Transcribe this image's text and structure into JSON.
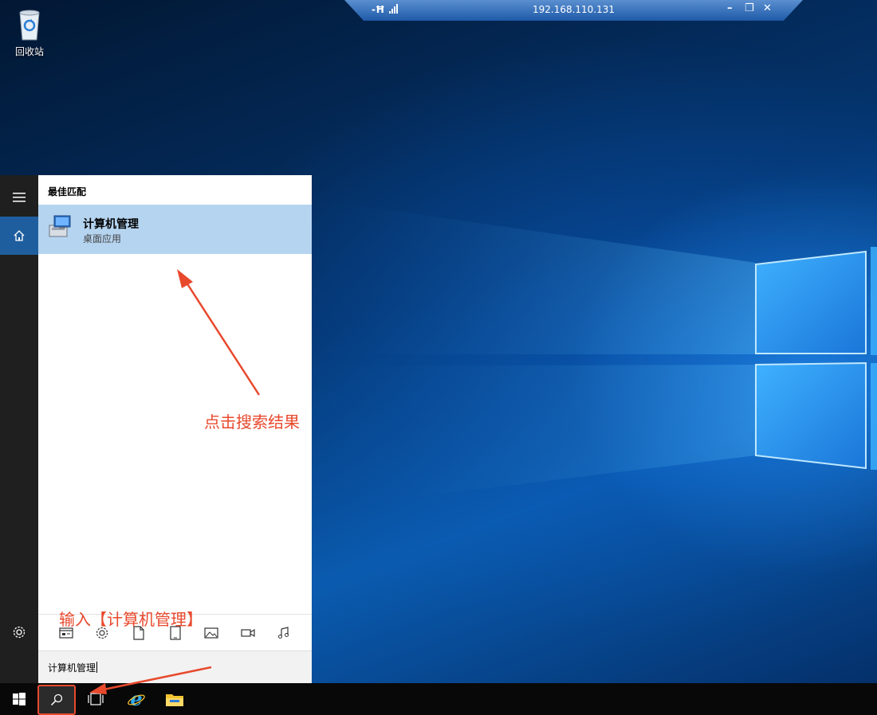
{
  "desktop": {
    "recycle_bin_label": "回收站"
  },
  "rdp_bar": {
    "host": "192.168.110.131"
  },
  "start_menu": {
    "best_match_heading": "最佳匹配",
    "result": {
      "name": "计算机管理",
      "type": "桌面应用"
    },
    "search_value": "计算机管理",
    "filter_icons": [
      "apps-icon",
      "settings-icon",
      "document-icon",
      "tablet-icon",
      "photo-icon",
      "video-icon",
      "music-icon"
    ]
  },
  "annotations": {
    "click_result": "点击搜索结果",
    "type_query": "输入【计算机管理】"
  },
  "colors": {
    "annotation": "#e8492d",
    "selected_result": "#b5d4f0",
    "rail_active": "#1f5e9e"
  }
}
